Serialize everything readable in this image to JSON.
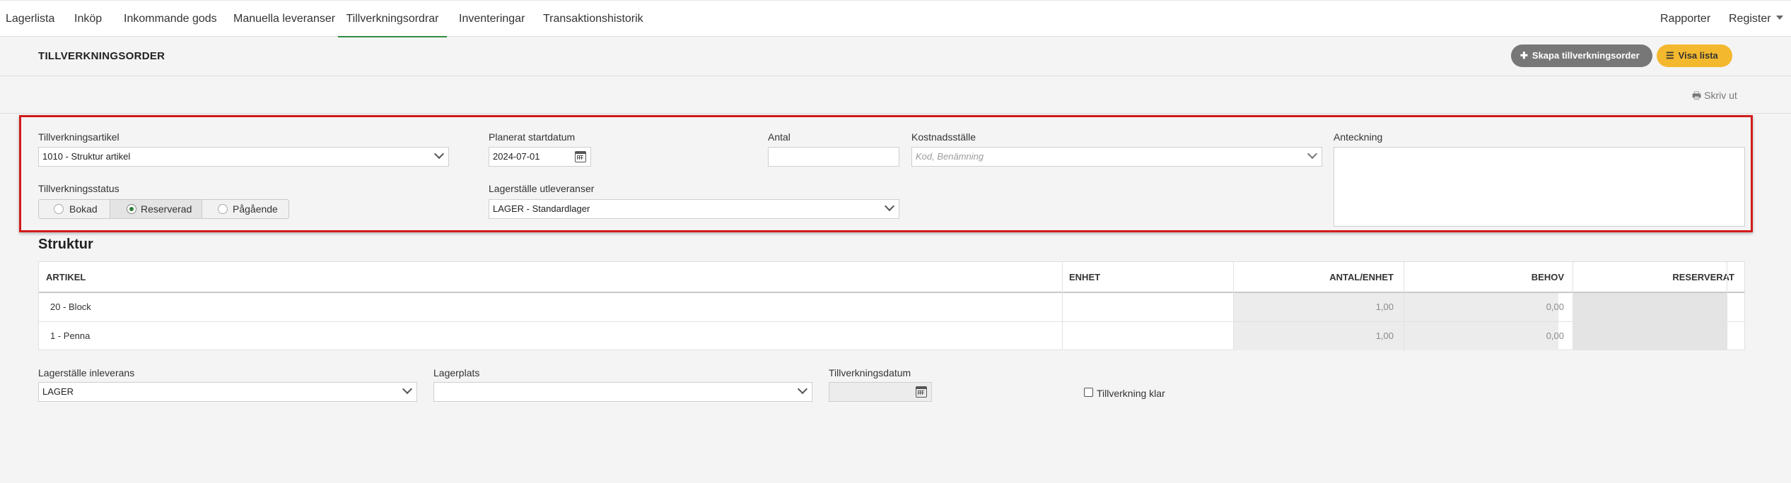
{
  "nav": {
    "items": [
      {
        "label": "Lagerlista"
      },
      {
        "label": "Inköp"
      },
      {
        "label": "Inkommande gods"
      },
      {
        "label": "Manuella leveranser"
      },
      {
        "label": "Tillverkningsordrar"
      },
      {
        "label": "Inventeringar"
      },
      {
        "label": "Transaktionshistorik"
      }
    ],
    "active": "Tillverkningsordrar",
    "right": {
      "reports": "Rapporter",
      "register": "Register"
    }
  },
  "header": {
    "title": "TILLVERKNINGSORDER",
    "create_button": "Skapa tillverkningsorder",
    "list_button": "Visa lista",
    "print": "Skriv ut"
  },
  "form": {
    "article_label": "Tillverkningsartikel",
    "article_value": "1010 - Struktur artikel",
    "start_date_label": "Planerat startdatum",
    "start_date_value": "2024-07-01",
    "quantity_label": "Antal",
    "quantity_value": "",
    "cost_center_label": "Kostnadsställe",
    "cost_center_placeholder": "Kod, Benämning",
    "note_label": "Anteckning",
    "note_value": "",
    "status_label": "Tillverkningsstatus",
    "status_options": [
      "Bokad",
      "Reserverad",
      "Pågående"
    ],
    "status_selected": "Reserverad",
    "outbound_location_label": "Lagerställe utleveranser",
    "outbound_location_value": "LAGER - Standardlager"
  },
  "structure": {
    "title": "Struktur",
    "columns": [
      "ARTIKEL",
      "ENHET",
      "ANTAL/ENHET",
      "BEHOV",
      "RESERVERAT"
    ],
    "rows": [
      {
        "article": "20 - Block",
        "unit": "",
        "qty_per_unit": "1,00",
        "need": "0,00",
        "reserved": ""
      },
      {
        "article": "1 - Penna",
        "unit": "",
        "qty_per_unit": "1,00",
        "need": "0,00",
        "reserved": ""
      }
    ]
  },
  "bottom": {
    "inbound_location_label": "Lagerställe inleverans",
    "inbound_location_value": "LAGER",
    "storage_place_label": "Lagerplats",
    "storage_place_value": "",
    "production_date_label": "Tillverkningsdatum",
    "production_date_value": "",
    "done_label": "Tillverkning klar"
  },
  "colors": {
    "accent_green": "#2f8f3f",
    "highlight_border": "#d21b1b",
    "create_button_bg": "#777777",
    "list_button_bg": "#f3b82e"
  }
}
